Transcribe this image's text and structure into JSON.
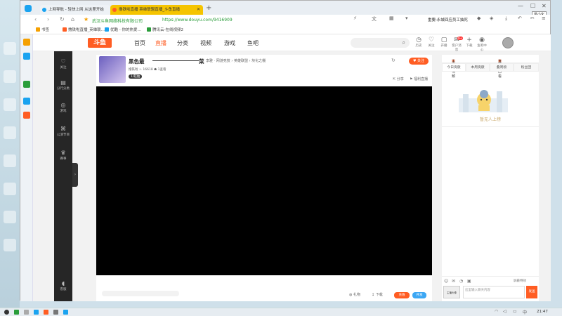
{
  "browser": {
    "tabs": [
      {
        "label": "上网导航 - 轻快上网 从这里开始",
        "color": "#1aa3f0"
      },
      {
        "label": "撸铁啦直播 英雄联盟直播_斗鱼直播",
        "color": "#ff5d23"
      }
    ],
    "new_tab": "+",
    "window_controls": {
      "minimize": "—",
      "maximize": "☐",
      "close": "✕"
    },
    "tooltip": "最小化",
    "site_name": "武汉斗鱼网络科技有限公司",
    "url": "https://www.douyu.com/9416909",
    "notice": "重要:永城回应员工抽死",
    "bookmarks": [
      "书签",
      "撸铁啦直播_英雄联...",
      "优酷 - 你的热爱...",
      "腾讯云-在线视频2"
    ]
  },
  "site": {
    "logo": "斗鱼",
    "nav": [
      "首页",
      "直播",
      "分类",
      "视频",
      "游戏",
      "鱼吧"
    ],
    "header_icons": [
      {
        "icon": "history-icon",
        "glyph": "◷",
        "label": "历史"
      },
      {
        "icon": "heart-icon",
        "glyph": "♡",
        "label": "关注"
      },
      {
        "icon": "tv-icon",
        "glyph": "▢",
        "label": "开播"
      },
      {
        "icon": "mail-icon",
        "glyph": "✉",
        "label": "客户消息",
        "badge": "9+"
      },
      {
        "icon": "plus-icon",
        "glyph": "+",
        "label": "下载"
      },
      {
        "icon": "pin-icon",
        "glyph": "◉",
        "label": "鱼吧中心"
      }
    ]
  },
  "left_dark_nav": [
    {
      "icon": "heart-icon",
      "glyph": "♡",
      "label": "关注"
    },
    {
      "icon": "category-icon",
      "glyph": "▤",
      "label": "分行分类"
    },
    {
      "icon": "gamepad-icon",
      "glyph": "◎",
      "label": "游戏"
    },
    {
      "icon": "controller-icon",
      "glyph": "⌘",
      "label": "公演节目"
    },
    {
      "icon": "trophy-icon",
      "glyph": "♛",
      "label": "赛事"
    },
    {
      "icon": "headset-icon",
      "glyph": "◖",
      "label": "客服"
    }
  ],
  "room": {
    "name": "黑色最",
    "name_tail": "菜",
    "category": "李雅 · 网游竞技 › 英雄联盟 › 块化之棚",
    "meta": "撸铁啦  ♨ 16618  ☗ 1查看",
    "level": "1/轻抽",
    "follow": "♥ 关注",
    "share": "分享",
    "report": "福利直播",
    "below_buttons": [
      "礼物",
      "下载",
      "充值",
      "开发"
    ],
    "btn_colors": [
      "#ff5d23",
      "#3ca7f4"
    ]
  },
  "right_panel": {
    "top_left": "主播视频",
    "top_right": "直播回看",
    "tabs": [
      "今日贡献",
      "本周贡献",
      "叠周榜",
      "粉丝团"
    ],
    "empty_text": "暂无人上榜",
    "chat_placeholder": "这里输入聊天内容",
    "send": "发送",
    "shield": "屏蔽特效",
    "avatar_label": "主播头像"
  },
  "taskbar": {
    "clock": "21:47"
  }
}
